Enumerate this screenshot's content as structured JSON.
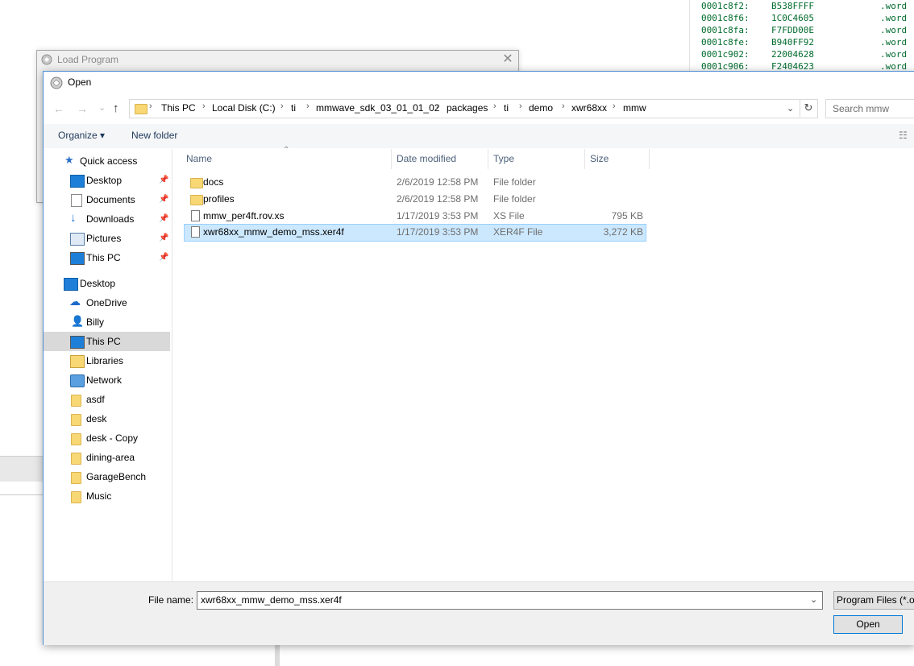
{
  "disassembly": [
    {
      "addr": "0001c8f2:",
      "hex": "B538FFFF",
      "op": ".word"
    },
    {
      "addr": "0001c8f6:",
      "hex": "1C0C4605",
      "op": ".word"
    },
    {
      "addr": "0001c8fa:",
      "hex": "F7FDD00E",
      "op": ".word"
    },
    {
      "addr": "0001c8fe:",
      "hex": "B940FF92",
      "op": ".word"
    },
    {
      "addr": "0001c902:",
      "hex": "22004628",
      "op": ".word"
    },
    {
      "addr": "0001c906:",
      "hex": "F2404623",
      "op": ".word"
    }
  ],
  "load_program": {
    "title": "Load Program",
    "close_glyph": "✕"
  },
  "open_dialog": {
    "title": "Open",
    "nav": {
      "back": "←",
      "forward": "→",
      "recent": "⌄",
      "up": "↑"
    },
    "breadcrumb": [
      "This PC",
      "Local Disk (C:)",
      "ti",
      "mmwave_sdk_03_01_01_02",
      "packages",
      "ti",
      "demo",
      "xwr68xx",
      "mmw"
    ],
    "search_placeholder": "Search mmw",
    "toolbar": {
      "organize": "Organize ▾",
      "new_folder": "New folder"
    },
    "sidebar": [
      {
        "label": "Quick access",
        "icon": "star-icon"
      },
      {
        "label": "Desktop",
        "icon": "desktop-icon",
        "pinned": true
      },
      {
        "label": "Documents",
        "icon": "documents-icon",
        "pinned": true
      },
      {
        "label": "Downloads",
        "icon": "download-icon",
        "pinned": true
      },
      {
        "label": "Pictures",
        "icon": "pictures-icon",
        "pinned": true
      },
      {
        "label": "This PC",
        "icon": "pc-icon",
        "pinned": true
      },
      {
        "label": "Desktop",
        "icon": "desktop-icon"
      },
      {
        "label": "OneDrive",
        "icon": "cloud-icon"
      },
      {
        "label": "Billy",
        "icon": "user-icon"
      },
      {
        "label": "This PC",
        "icon": "pc-icon",
        "selected": true
      },
      {
        "label": "Libraries",
        "icon": "libraries-icon"
      },
      {
        "label": "Network",
        "icon": "network-icon"
      },
      {
        "label": "asdf",
        "icon": "folder-icon"
      },
      {
        "label": "desk",
        "icon": "folder-icon"
      },
      {
        "label": "desk - Copy",
        "icon": "folder-icon"
      },
      {
        "label": "dining-area",
        "icon": "folder-icon"
      },
      {
        "label": "GarageBench",
        "icon": "folder-icon"
      },
      {
        "label": "Music",
        "icon": "folder-icon"
      }
    ],
    "columns": {
      "name": "Name",
      "date": "Date modified",
      "type": "Type",
      "size": "Size"
    },
    "files": [
      {
        "name": "docs",
        "date": "2/6/2019 12:58 PM",
        "type": "File folder",
        "size": "",
        "icon": "folder-icon"
      },
      {
        "name": "profiles",
        "date": "2/6/2019 12:58 PM",
        "type": "File folder",
        "size": "",
        "icon": "folder-icon"
      },
      {
        "name": "mmw_per4ft.rov.xs",
        "date": "1/17/2019 3:53 PM",
        "type": "XS File",
        "size": "795 KB",
        "icon": "file-icon"
      },
      {
        "name": "xwr68xx_mmw_demo_mss.xer4f",
        "date": "1/17/2019 3:53 PM",
        "type": "XER4F File",
        "size": "3,272 KB",
        "icon": "file-icon",
        "selected": true
      }
    ],
    "file_name_label": "File name:",
    "file_name_value": "xwr68xx_mmw_demo_mss.xer4f",
    "filter_value": "Program Files (*.out",
    "open_button": "Open"
  },
  "colors": {
    "accent": "#0078d7",
    "selection": "#cce8ff",
    "disasm_text": "#006b2d",
    "folder": "#f8d775"
  }
}
